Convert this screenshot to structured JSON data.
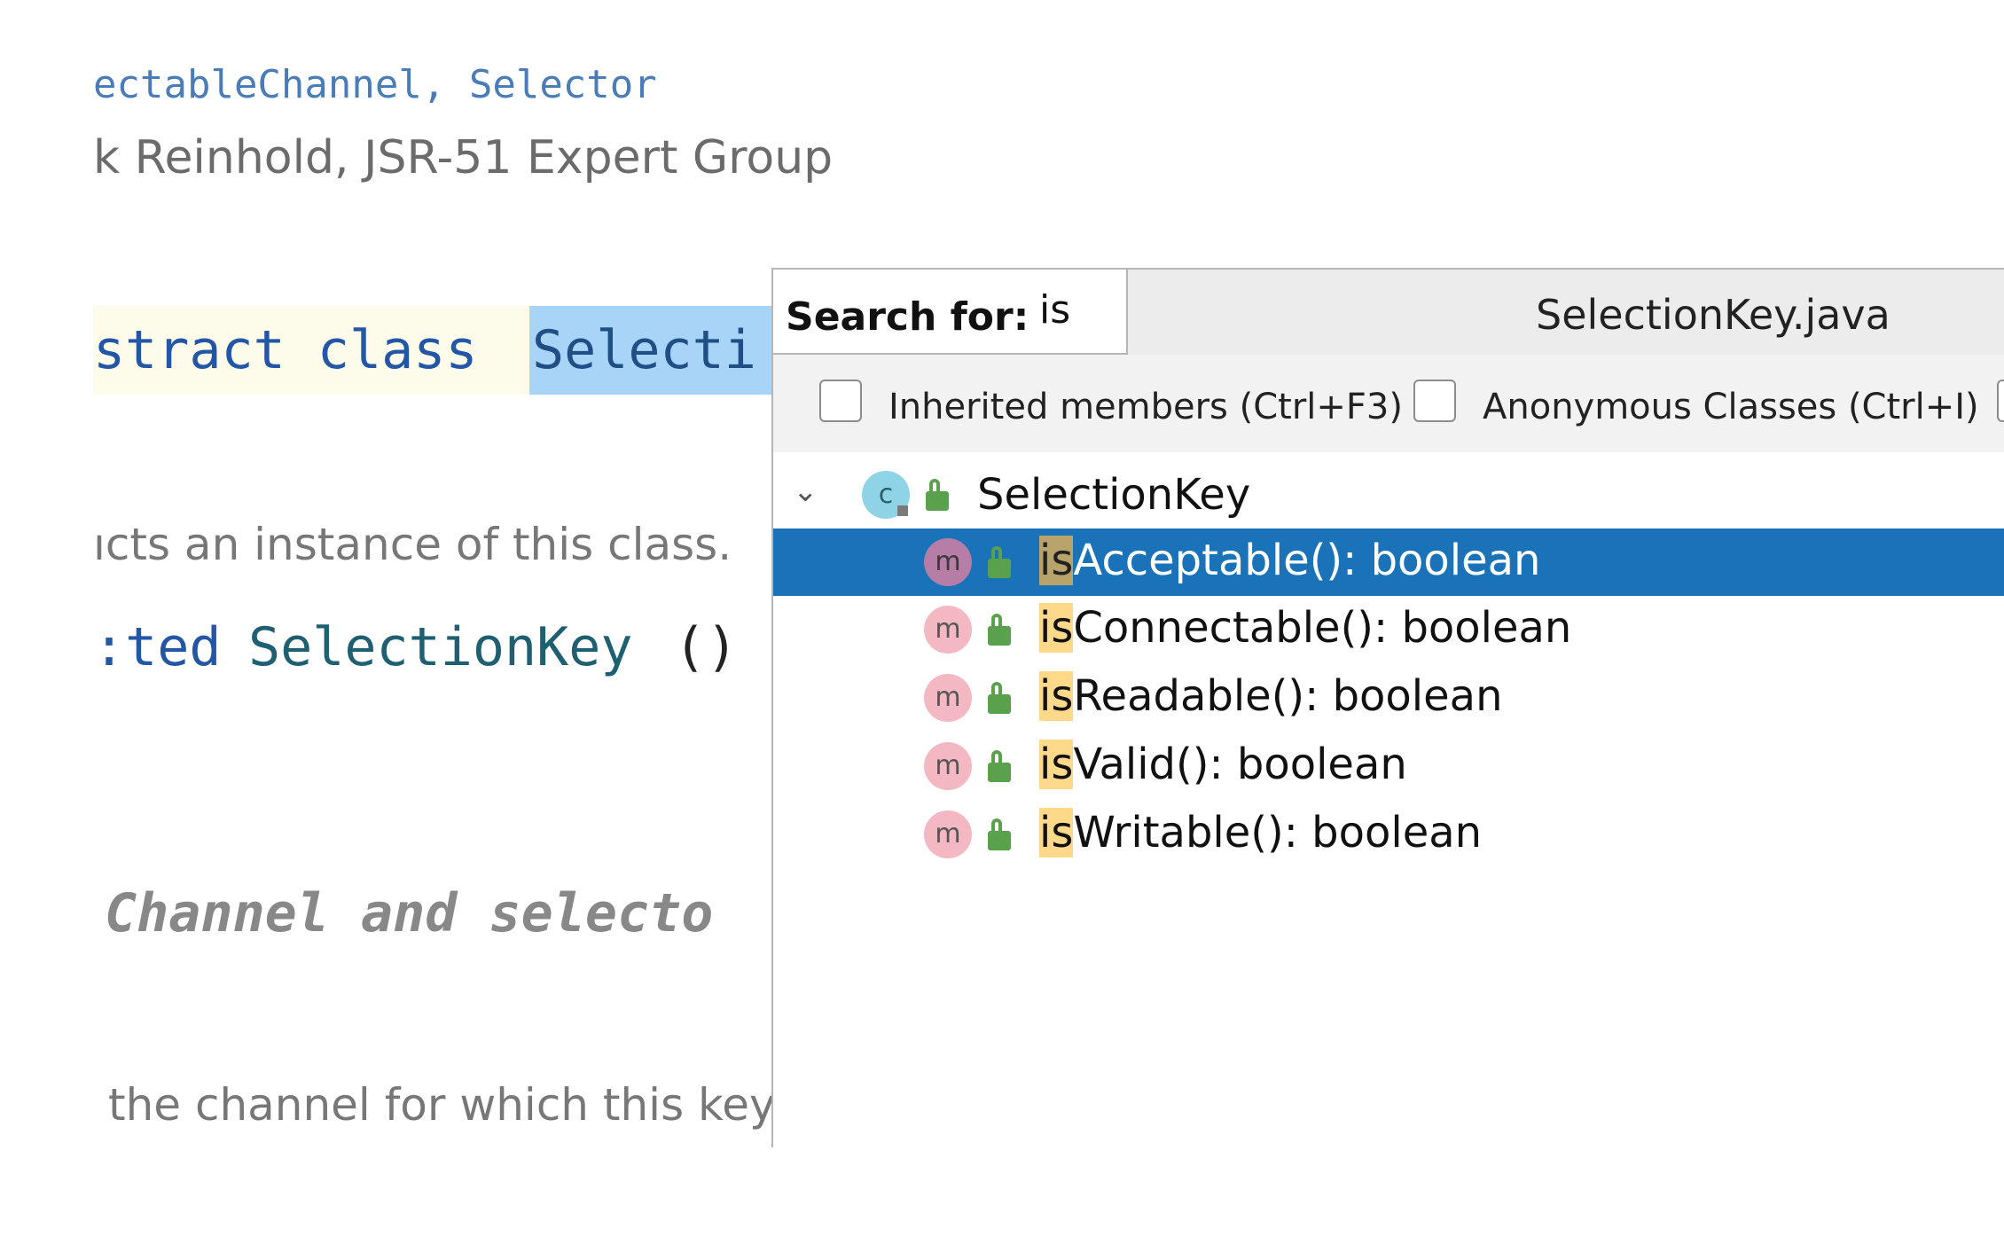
{
  "editor": {
    "implements_line": "ectableChannel, Selector",
    "author_line": "k Reinhold, JSR-51 Expert Group",
    "class_keywords": "stract class ",
    "class_name_fragment": "Selecti",
    "constructs_doc": "ıcts an instance of this class.",
    "ctor_keyword": ":ted ",
    "ctor_name": "SelectionKey",
    "ctor_paren": "()",
    "channel_line": "Channel and selecto",
    "channel_doc": "the channel for which this key w"
  },
  "popup": {
    "search_label": "Search for:",
    "search_value": "is",
    "file_title": "SelectionKey.java",
    "options": {
      "inherited_label": "Inherited members (Ctrl+F3)",
      "inherited_checked": false,
      "anonymous_label": "Anonymous Classes (Ctrl+I)",
      "anonymous_checked": false
    },
    "tree": {
      "class_node": {
        "icon": "class-icon",
        "icon_letter": "c",
        "label": "SelectionKey",
        "expanded": true
      },
      "members": [
        {
          "match": "is",
          "rest": "Acceptable(): boolean",
          "icon_letter": "m",
          "selected": true
        },
        {
          "match": "is",
          "rest": "Connectable(): boolean",
          "icon_letter": "m",
          "selected": false
        },
        {
          "match": "is",
          "rest": "Readable(): boolean",
          "icon_letter": "m",
          "selected": false
        },
        {
          "match": "is",
          "rest": "Valid(): boolean",
          "icon_letter": "m",
          "selected": false
        },
        {
          "match": "is",
          "rest": "Writable(): boolean",
          "icon_letter": "m",
          "selected": false
        }
      ]
    }
  },
  "colors": {
    "selection": "#1a73b8",
    "match_highlight": "#ffd98a",
    "method_icon": "#f4b8c2",
    "public_lock": "#59a14c"
  }
}
